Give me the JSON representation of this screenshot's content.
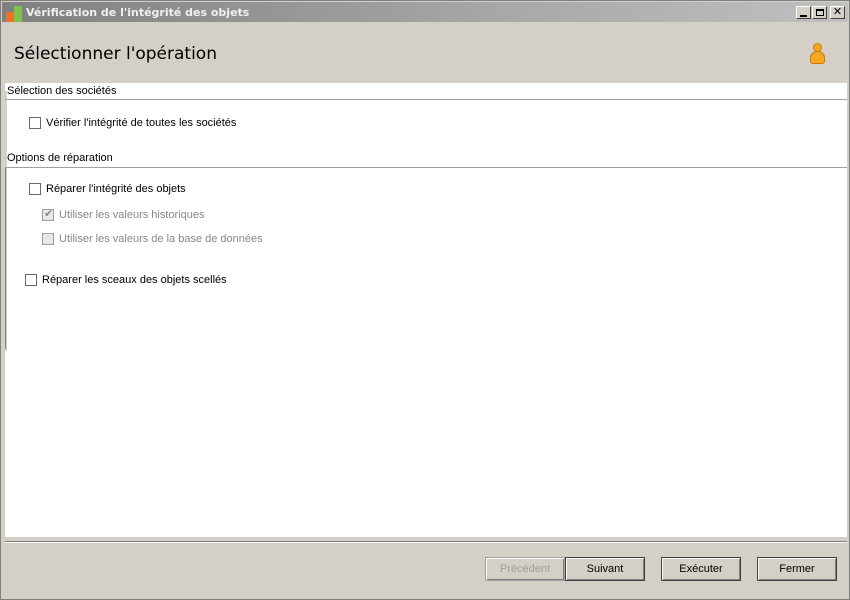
{
  "window": {
    "title": "Vérification de l'intégrité des objets",
    "close_glyph": "✕"
  },
  "header": {
    "title": "Sélectionner l'opération",
    "icon": "user-icon"
  },
  "sections": {
    "companies": {
      "label": "Sélection des sociétés",
      "check_all_label": "Vérifier l'intégrité de toutes les sociétés",
      "check_all_checked": false
    },
    "repair": {
      "label": "Options de réparation",
      "repair_integrity_label": "Réparer l'intégrité des objets",
      "repair_integrity_checked": false,
      "historic_values_label": "Utiliser les valeurs historiques",
      "historic_values_checked": true,
      "database_values_label": "Utiliser les valeurs de la base de données",
      "database_values_checked": false,
      "repair_seals_label": "Réparer les sceaux des objets scellés",
      "repair_seals_checked": false
    }
  },
  "buttons": {
    "previous": "Précédent",
    "next": "Suivant",
    "execute": "Exécuter",
    "close": "Fermer"
  },
  "colors": {
    "titlebar": "#808080",
    "window_bg": "#d4d0c8",
    "user_icon": "#f5a623"
  }
}
